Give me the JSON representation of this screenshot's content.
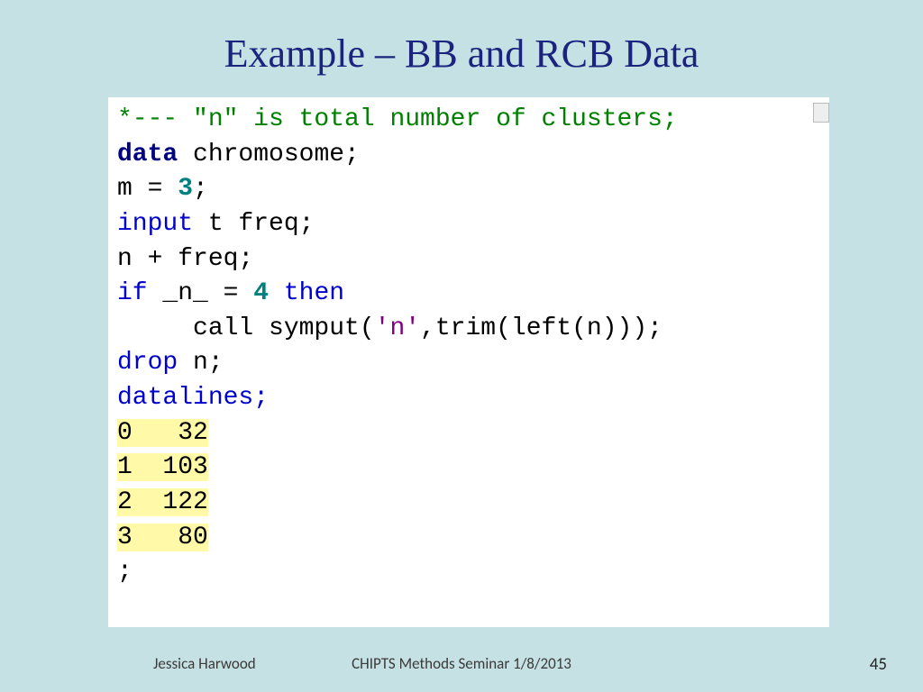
{
  "slide": {
    "title": "Example – BB and RCB Data"
  },
  "code": {
    "comment": "*--- \"n\" is total number of clusters;",
    "l2_kw": "data",
    "l2_rest": " chromosome;",
    "l3_a": "m = ",
    "l3_num": "3",
    "l3_b": ";",
    "l4_kw": "input",
    "l4_rest": " t freq;",
    "l5": "n + freq;",
    "l6_kw": "if",
    "l6_mid": " _n_ = ",
    "l6_num": "4",
    "l6_then": " then",
    "l7_a": "     call symput(",
    "l7_str": "'n'",
    "l7_b": ",trim(left(n)));",
    "l8_kw": "drop",
    "l8_rest": " n;",
    "l9": "datalines;",
    "d1": "0   32",
    "d2": "1  103",
    "d3": "2  122",
    "d4": "3   80",
    "semi": ";"
  },
  "footer": {
    "author": "Jessica Harwood",
    "seminar": "CHIPTS Methods Seminar 1/8/2013",
    "page": "45"
  }
}
